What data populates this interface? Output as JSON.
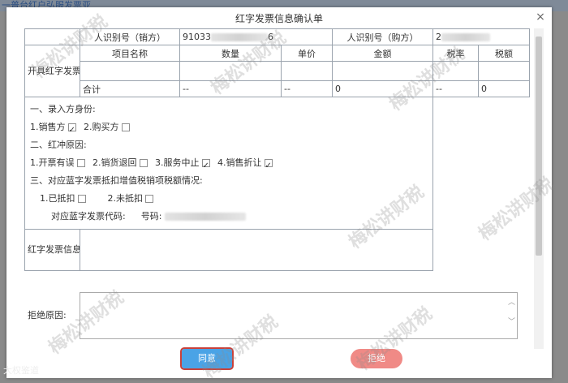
{
  "background": {
    "strip_text": "一普台红户弘服发票亚"
  },
  "dialog": {
    "title": "红字发票信息确认单",
    "close_icon": "close-icon"
  },
  "info_table": {
    "taxpayer_id_seller_label": "人识别号（销方）",
    "taxpayer_id_seller_value": "91033",
    "taxpayer_id_seller_suffix": "6",
    "taxpayer_id_buyer_label": "人识别号（购方）",
    "taxpayer_id_buyer_value": "2",
    "side_label": "开具红字发票确认信息内容",
    "columns": [
      "项目名称",
      "数量",
      "单价",
      "金额",
      "税率",
      "税额"
    ],
    "total_row": [
      "合计",
      "--",
      "--",
      "0",
      "--",
      "0"
    ]
  },
  "section": {
    "entry_heading": "一、录入方身份:",
    "entry_options": [
      {
        "label": "1.销售方",
        "checked": true
      },
      {
        "label": "2.购买方",
        "checked": false
      }
    ],
    "reason_heading": "二、红冲原因:",
    "reason_options": [
      {
        "label": "1.开票有误",
        "checked": false
      },
      {
        "label": "2.销货退回",
        "checked": false
      },
      {
        "label": "3.服务中止",
        "checked": true
      },
      {
        "label": "4.销售折让",
        "checked": true
      }
    ],
    "deduct_heading": "三、对应蓝字发票抵扣增值税销项税额情况:",
    "deduct_options": [
      {
        "label": "1.已抵扣",
        "checked": false
      },
      {
        "label": "2.未抵扣",
        "checked": false
      }
    ],
    "blue_invoice_code_label": "对应蓝字发票代码:",
    "blue_invoice_number_label": "号码:"
  },
  "confirm_no_label": "红字发票信息确认单编号",
  "reject_reason_label": "拒绝原因:",
  "buttons": {
    "agree": "同意",
    "reject": "拒绝"
  },
  "watermark": {
    "text": "梅松讲财税"
  },
  "corner_label": "大权鉴道"
}
